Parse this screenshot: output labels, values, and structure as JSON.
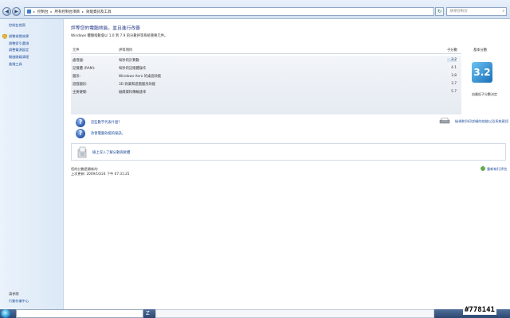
{
  "address": {
    "crumbs": [
      "控制台",
      "所有控制台項目",
      "效能資訊及工具"
    ],
    "search_placeholder": "搜尋控制台"
  },
  "sidebar": {
    "top_link": "控制台首頁",
    "items": [
      {
        "label": "調整視覺效果"
      },
      {
        "label": "調整索引選項"
      },
      {
        "label": "調整電源設定"
      },
      {
        "label": "開啟磁碟清理"
      },
      {
        "label": "進階工具"
      }
    ],
    "see_also": "請參閱",
    "bottom_link": "行動作業中心"
  },
  "main": {
    "title": "評等您的電腦效能，並且進行改善",
    "subtitle": "Windows 體驗指數會以 1.0 到 7.9 的分數評等系統重要元件。",
    "columns": {
      "component": "元件",
      "rated": "評等項目",
      "subscore": "子分數",
      "basescore": "基本分數"
    },
    "rows": [
      {
        "component": "處理器:",
        "rated": "每秒的計算數",
        "subscore": "3.2",
        "selected": true
      },
      {
        "component": "記憶體 (RAM):",
        "rated": "每秒的記憶體操作",
        "subscore": "4.1",
        "selected": false
      },
      {
        "component": "圖形:",
        "rated": "Windows Aero 的桌面效能",
        "subscore": "3.8",
        "selected": false
      },
      {
        "component": "遊戲圖形:",
        "rated": "3D 商業和遊戲圖形效能",
        "subscore": "3.7",
        "selected": false
      },
      {
        "component": "主要硬碟:",
        "rated": "磁碟資料傳輸速率",
        "subscore": "5.7",
        "selected": false
      }
    ],
    "base_score": "3.2",
    "base_caption": "由最低子分數決定",
    "help_links": [
      "這些數字代表什麼?",
      "改善電腦效能的秘訣。"
    ],
    "print_link": "檢視和列印詳細的效能以及系統資訊",
    "info_link": "線上深入了解分數與軟體",
    "status_line1": "您的分數是最新的",
    "status_line2": "上次更新: 2009/10/24 下午 07:31:25",
    "rerun_label": "重新執行評估"
  },
  "taskbar": {
    "watermark": "#778141"
  },
  "colors": {
    "link": "#1b4a9a",
    "title": "#1e3287",
    "sidebar_bg": "#e3edf8",
    "score_badge": "#1a6fb8"
  }
}
